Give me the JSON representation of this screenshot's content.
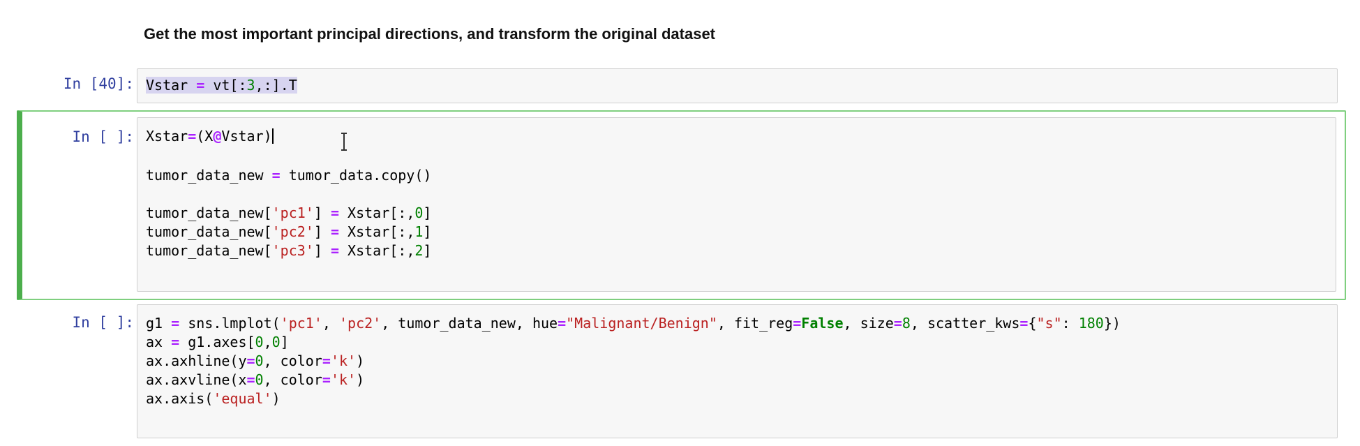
{
  "markdown": {
    "heading": "Get the most important principal directions, and transform the original dataset"
  },
  "cells": [
    {
      "prompt": "In [40]:",
      "lines": [
        [
          {
            "t": "Vstar",
            "c": "sel"
          },
          {
            "t": " ",
            "c": "sel"
          },
          {
            "t": "=",
            "c": "sel o"
          },
          {
            "t": " vt[:",
            "c": "sel"
          },
          {
            "t": "3",
            "c": "sel n"
          },
          {
            "t": ",:].T",
            "c": "sel"
          }
        ]
      ]
    },
    {
      "prompt": "In [ ]:",
      "lines": [
        [
          {
            "t": "Xstar"
          },
          {
            "t": "=",
            "c": "o"
          },
          {
            "t": "(X"
          },
          {
            "t": "@",
            "c": "o"
          },
          {
            "t": "Vstar)"
          }
        ],
        [],
        [
          {
            "t": "tumor_data_new "
          },
          {
            "t": "=",
            "c": "o"
          },
          {
            "t": " tumor_data.copy()"
          }
        ],
        [],
        [
          {
            "t": "tumor_data_new["
          },
          {
            "t": "'pc1'",
            "c": "s"
          },
          {
            "t": "] "
          },
          {
            "t": "=",
            "c": "o"
          },
          {
            "t": " Xstar[:,"
          },
          {
            "t": "0",
            "c": "n"
          },
          {
            "t": "]"
          }
        ],
        [
          {
            "t": "tumor_data_new["
          },
          {
            "t": "'pc2'",
            "c": "s"
          },
          {
            "t": "] "
          },
          {
            "t": "=",
            "c": "o"
          },
          {
            "t": " Xstar[:,"
          },
          {
            "t": "1",
            "c": "n"
          },
          {
            "t": "]"
          }
        ],
        [
          {
            "t": "tumor_data_new["
          },
          {
            "t": "'pc3'",
            "c": "s"
          },
          {
            "t": "] "
          },
          {
            "t": "=",
            "c": "o"
          },
          {
            "t": " Xstar[:,"
          },
          {
            "t": "2",
            "c": "n"
          },
          {
            "t": "]"
          }
        ]
      ]
    },
    {
      "prompt": "In [ ]:",
      "lines": [
        [
          {
            "t": "g1 "
          },
          {
            "t": "=",
            "c": "o"
          },
          {
            "t": " sns.lmplot("
          },
          {
            "t": "'pc1'",
            "c": "s"
          },
          {
            "t": ", "
          },
          {
            "t": "'pc2'",
            "c": "s"
          },
          {
            "t": ", tumor_data_new, hue"
          },
          {
            "t": "=",
            "c": "o"
          },
          {
            "t": "\"Malignant/Benign\"",
            "c": "s"
          },
          {
            "t": ", fit_reg"
          },
          {
            "t": "=",
            "c": "o"
          },
          {
            "t": "False",
            "c": "k"
          },
          {
            "t": ", size"
          },
          {
            "t": "=",
            "c": "o"
          },
          {
            "t": "8",
            "c": "n"
          },
          {
            "t": ", scatter_kws"
          },
          {
            "t": "=",
            "c": "o"
          },
          {
            "t": "{"
          },
          {
            "t": "\"s\"",
            "c": "s"
          },
          {
            "t": ": "
          },
          {
            "t": "180",
            "c": "n"
          },
          {
            "t": "})"
          }
        ],
        [
          {
            "t": "ax "
          },
          {
            "t": "=",
            "c": "o"
          },
          {
            "t": " g1.axes["
          },
          {
            "t": "0",
            "c": "n"
          },
          {
            "t": ","
          },
          {
            "t": "0",
            "c": "n"
          },
          {
            "t": "]"
          }
        ],
        [
          {
            "t": "ax.axhline(y"
          },
          {
            "t": "=",
            "c": "o"
          },
          {
            "t": "0",
            "c": "n"
          },
          {
            "t": ", color"
          },
          {
            "t": "=",
            "c": "o"
          },
          {
            "t": "'k'",
            "c": "s"
          },
          {
            "t": ")"
          }
        ],
        [
          {
            "t": "ax.axvline(x"
          },
          {
            "t": "=",
            "c": "o"
          },
          {
            "t": "0",
            "c": "n"
          },
          {
            "t": ", color"
          },
          {
            "t": "=",
            "c": "o"
          },
          {
            "t": "'k'",
            "c": "s"
          },
          {
            "t": ")"
          }
        ],
        [
          {
            "t": "ax.axis("
          },
          {
            "t": "'equal'",
            "c": "s"
          },
          {
            "t": ")"
          }
        ]
      ]
    }
  ]
}
